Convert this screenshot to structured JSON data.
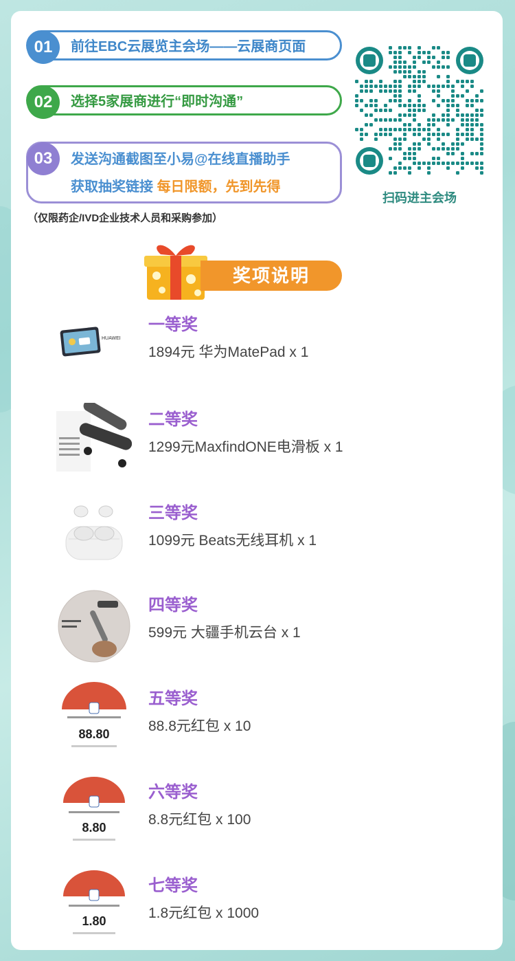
{
  "steps": [
    {
      "num": "01",
      "text": "前往EBC云展览主会场——云展商页面"
    },
    {
      "num": "02",
      "text": "选择5家展商进行“即时沟通”"
    },
    {
      "num": "03",
      "line1": "发送沟通截图至小易@在线直播助手",
      "line2_prefix": "获取抽奖链接 ",
      "line2_highlight": "每日限额，先到先得"
    }
  ],
  "qr": {
    "caption": "扫码进主会场"
  },
  "note": "（仅限药企/IVD企业技术人员和采购参加）",
  "prizes_section": {
    "title": "奖项说明"
  },
  "prizes": [
    {
      "level": "一等奖",
      "desc": "1894元 华为MatePad x 1",
      "image": "huawei-matepad-image",
      "brand_text": "HUAWEI"
    },
    {
      "level": "二等奖",
      "desc": "1299元MaxfindONE电滑板 x 1",
      "image": "electric-skateboard-image"
    },
    {
      "level": "三等奖",
      "desc": "1099元 Beats无线耳机 x 1",
      "image": "beats-earbuds-image"
    },
    {
      "level": "四等奖",
      "desc": "599元 大疆手机云台 x 1",
      "image": "dji-gimbal-image"
    },
    {
      "level": "五等奖",
      "desc": "88.8元红包 x 10",
      "image": "red-envelope-image",
      "amount": "88.80"
    },
    {
      "level": "六等奖",
      "desc": "8.8元红包 x 100",
      "image": "red-envelope-image",
      "amount": "8.80"
    },
    {
      "level": "七等奖",
      "desc": "1.8元红包 x 1000",
      "image": "red-envelope-image",
      "amount": "1.80"
    }
  ],
  "colors": {
    "blue": "#4a8fd0",
    "green": "#3ea84a",
    "purple": "#8f7fd2",
    "orange": "#f1962b",
    "prize_purple": "#9a5fcf",
    "qr_teal": "#1a8a86"
  }
}
